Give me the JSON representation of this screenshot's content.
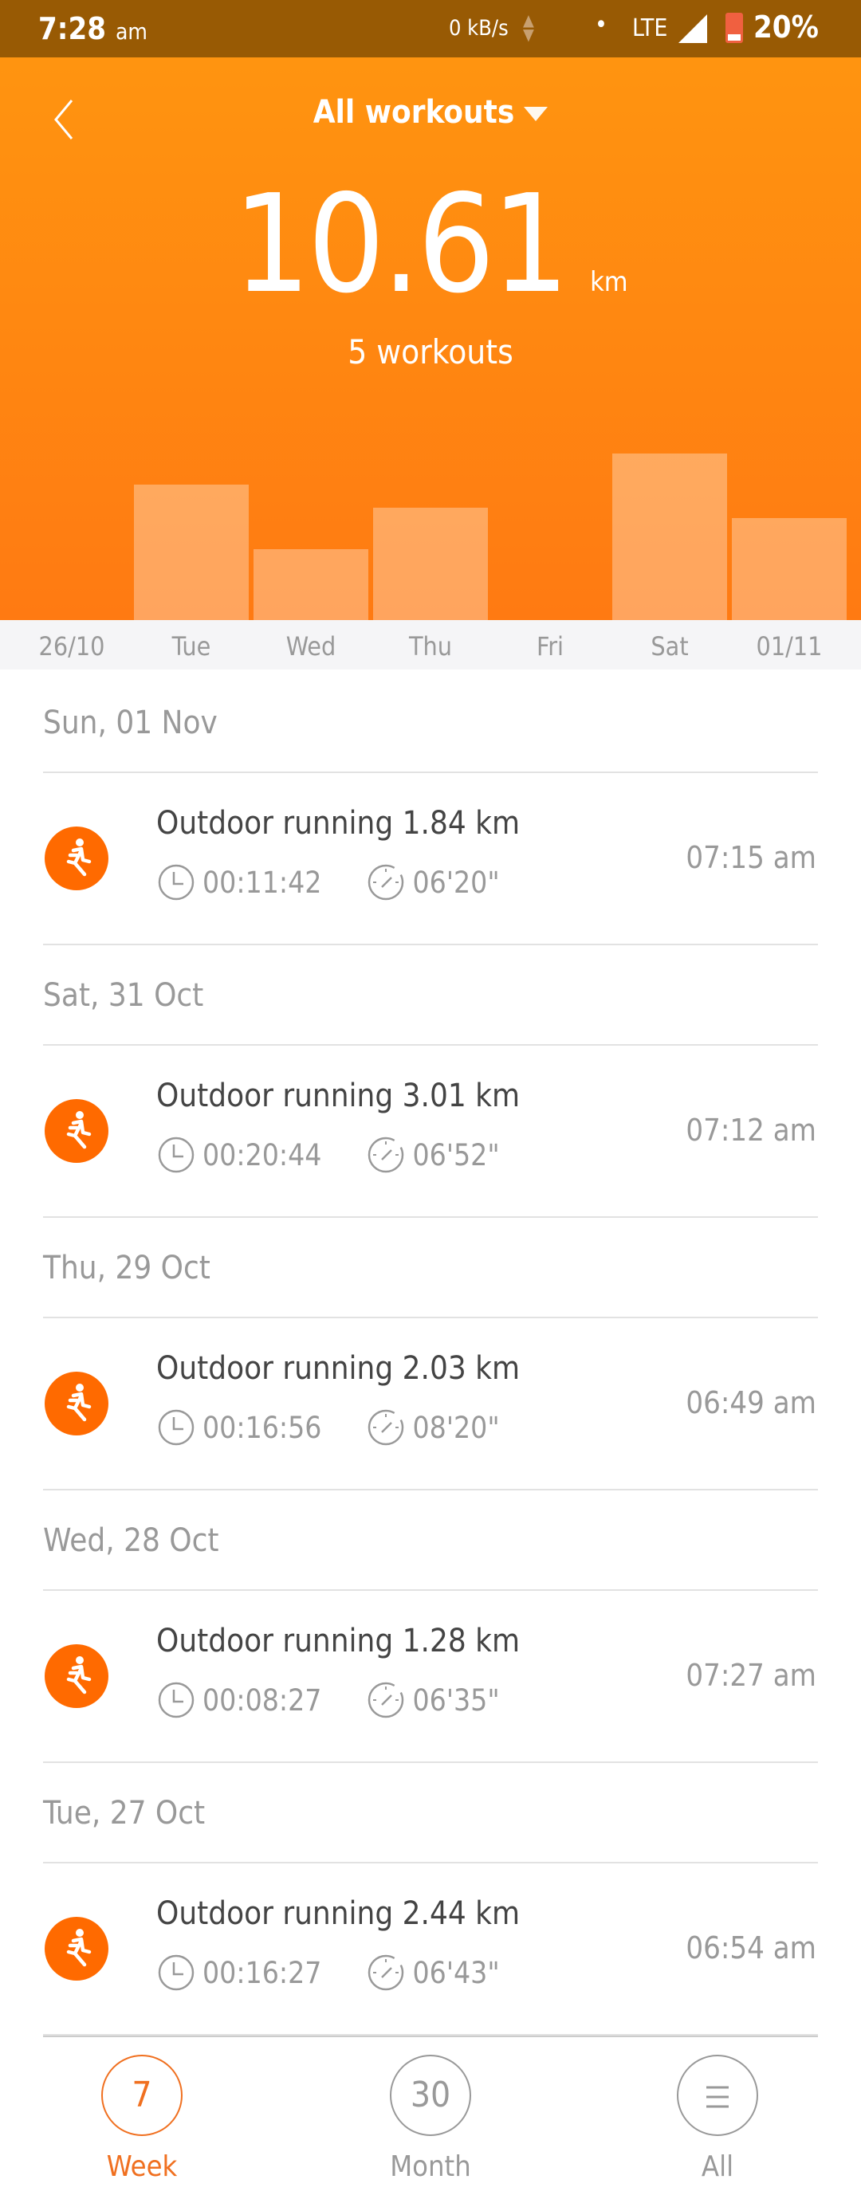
{
  "status_bar": {
    "time": "7:28",
    "ampm": "am",
    "net_speed": "0 kB/s",
    "network": "LTE",
    "battery": "20%"
  },
  "header": {
    "title": "All workouts",
    "total_distance": "10.61",
    "unit": "km",
    "workout_count": "5 workouts"
  },
  "chart_data": {
    "type": "bar",
    "categories": [
      "26/10",
      "Tue",
      "Wed",
      "Thu",
      "Fri",
      "Sat",
      "01/11"
    ],
    "values": [
      0,
      2.44,
      1.28,
      2.03,
      0,
      3.01,
      1.84
    ],
    "unit": "km"
  },
  "colors": {
    "accent": "#ff7a12",
    "status_bar": "#985a04",
    "icon": "#ff6a00"
  },
  "sections": [
    {
      "date": "Sun, 01 Nov",
      "workouts": [
        {
          "title": "Outdoor running 1.84 km",
          "duration": "00:11:42",
          "pace": "06'20\"",
          "time": "07:15 am"
        }
      ]
    },
    {
      "date": "Sat, 31 Oct",
      "workouts": [
        {
          "title": "Outdoor running 3.01 km",
          "duration": "00:20:44",
          "pace": "06'52\"",
          "time": "07:12 am"
        }
      ]
    },
    {
      "date": "Thu, 29 Oct",
      "workouts": [
        {
          "title": "Outdoor running 2.03 km",
          "duration": "00:16:56",
          "pace": "08'20\"",
          "time": "06:49 am"
        }
      ]
    },
    {
      "date": "Wed, 28 Oct",
      "workouts": [
        {
          "title": "Outdoor running 1.28 km",
          "duration": "00:08:27",
          "pace": "06'35\"",
          "time": "07:27 am"
        }
      ]
    },
    {
      "date": "Tue, 27 Oct",
      "workouts": [
        {
          "title": "Outdoor running 2.44 km",
          "duration": "00:16:27",
          "pace": "06'43\"",
          "time": "06:54 am"
        }
      ]
    }
  ],
  "bottom_nav": {
    "selected": "Week",
    "tabs": [
      {
        "icon_text": "7",
        "label": "Week"
      },
      {
        "icon_text": "30",
        "label": "Month"
      },
      {
        "icon_text": "",
        "label": "All"
      }
    ]
  }
}
